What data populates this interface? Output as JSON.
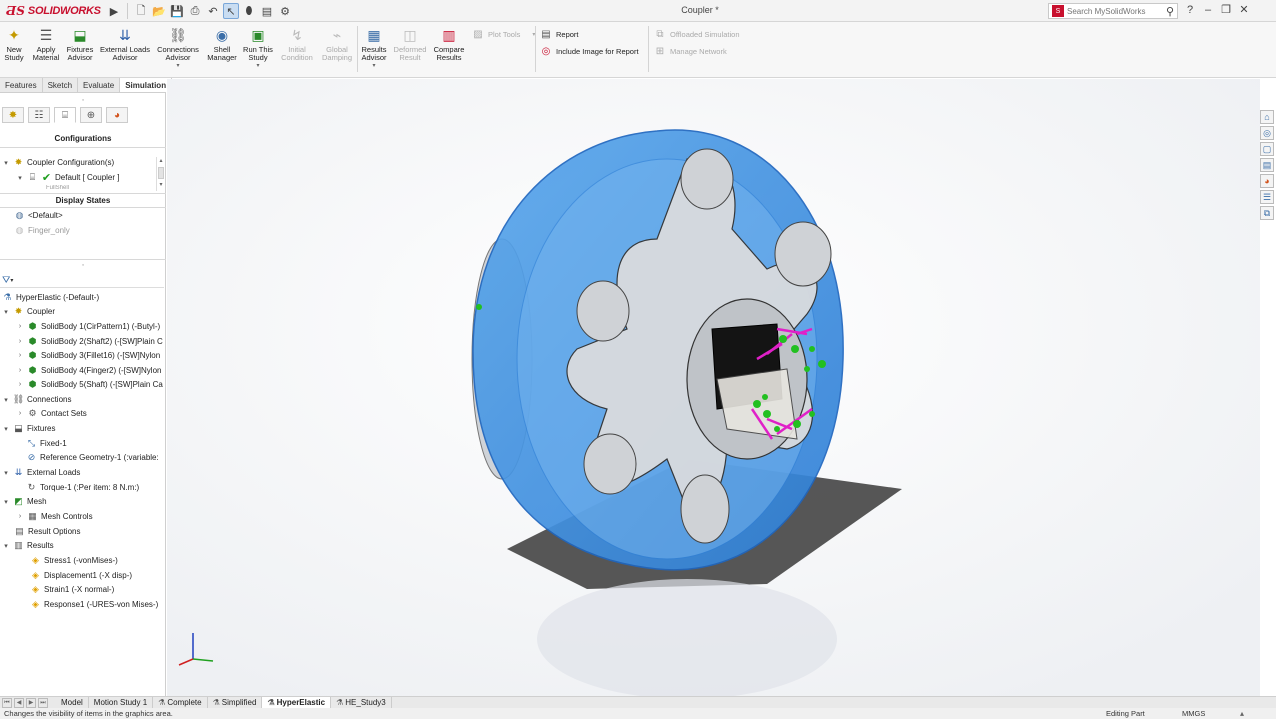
{
  "app": {
    "brand": "SOLIDWORKS",
    "document_title": "Coupler *",
    "search_placeholder": "Search MySolidWorks",
    "colors": {
      "brand": "#c8102e",
      "accent": "#3b6ea8",
      "part_blue": "#3d8fe0",
      "load_magenta": "#e020c8",
      "fixture_green": "#22c020"
    }
  },
  "ribbon": {
    "new_study": "New Study",
    "apply_material": "Apply Material",
    "fixtures_advisor": "Fixtures Advisor",
    "external_loads_advisor": "External Loads Advisor",
    "connections_advisor": "Connections Advisor",
    "shell_manager": "Shell Manager",
    "run_this_study": "Run This Study",
    "initial_condition": "Initial Condition",
    "global_damping": "Global Damping",
    "results_advisor": "Results Advisor",
    "deformed_result": "Deformed Result",
    "compare_results": "Compare Results",
    "plot_tools": "Plot Tools",
    "report": "Report",
    "include_image_for_report": "Include Image for Report",
    "offloaded_simulation": "Offloaded Simulation",
    "manage_network": "Manage Network"
  },
  "command_tabs": [
    "Features",
    "Sketch",
    "Evaluate",
    "Simulation"
  ],
  "configurations": {
    "header": "Configurations",
    "root": "Coupler Configuration(s)",
    "default": "Default [ Coupler ]",
    "next": "FullShell"
  },
  "display_states": {
    "header": "Display States",
    "items": [
      "<Default>",
      "Finger_only"
    ]
  },
  "tree": {
    "study": "HyperElastic (-Default-)",
    "part": "Coupler",
    "bodies": [
      "SolidBody 1(CirPattern1) (-Butyl-)",
      "SolidBody 2(Shaft2) (-[SW]Plain C",
      "SolidBody 3(Fillet16) (-[SW]Nylon",
      "SolidBody 4(Finger2) (-[SW]Nylon",
      "SolidBody 5(Shaft) (-[SW]Plain Ca"
    ],
    "connections": "Connections",
    "contact_sets": "Contact Sets",
    "fixtures": "Fixtures",
    "fixed1": "Fixed-1",
    "refgeom": "Reference Geometry-1 (:variable:",
    "external_loads": "External Loads",
    "torque": "Torque-1 (:Per item: 8 N.m:)",
    "mesh": "Mesh",
    "mesh_controls": "Mesh Controls",
    "result_options": "Result Options",
    "results": "Results",
    "result_items": [
      "Stress1 (-vonMises-)",
      "Displacement1 (-X disp-)",
      "Strain1 (-X normal-)",
      "Response1 (-URES-von Mises-)"
    ]
  },
  "bottom_tabs": [
    "Model",
    "Motion Study 1",
    "Complete",
    "Simplified",
    "HyperElastic",
    "HE_Study3"
  ],
  "status": {
    "message": "Changes the visibility of items in the graphics area.",
    "mode": "Editing Part",
    "units": "MMGS"
  }
}
